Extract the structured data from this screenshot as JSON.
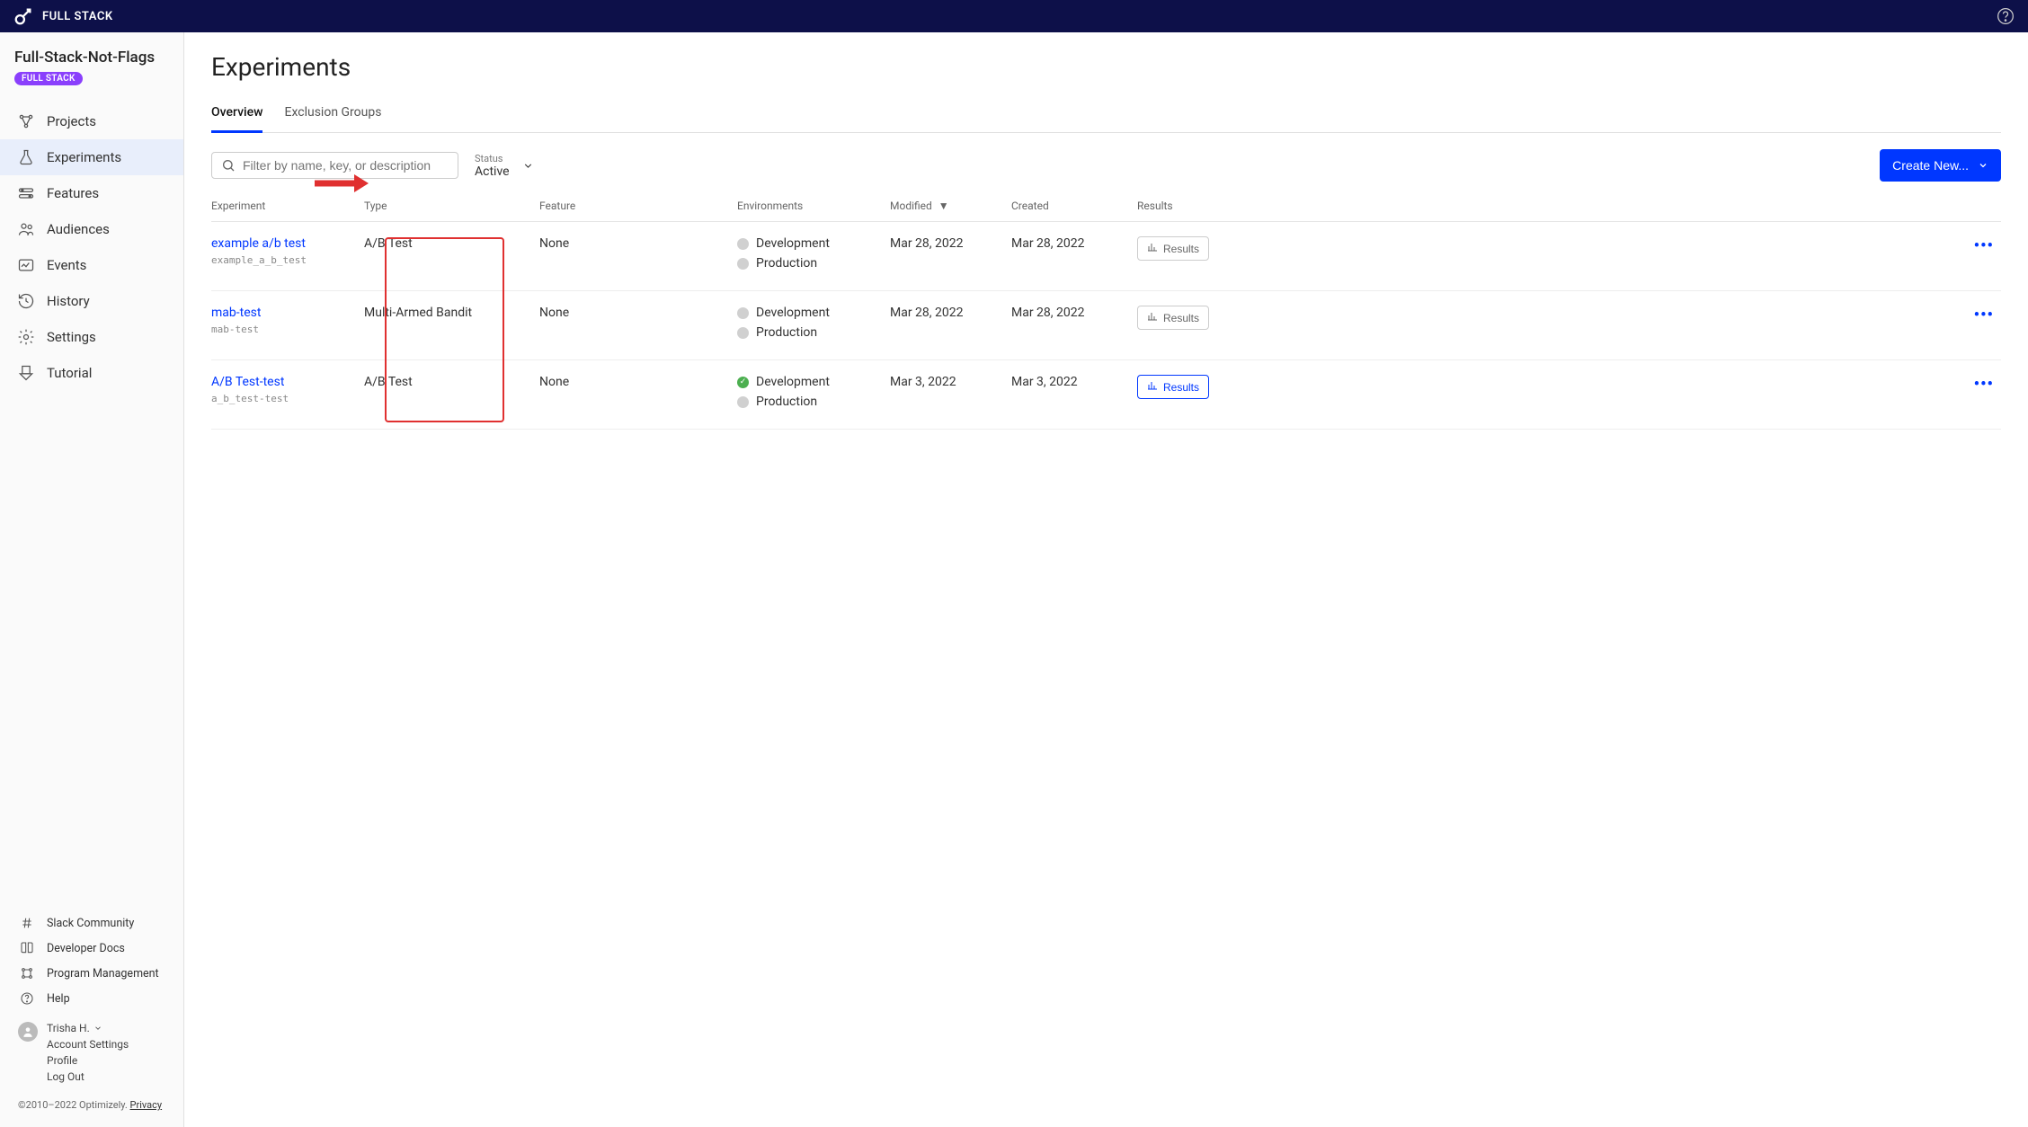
{
  "topbar": {
    "product": "FULL STACK"
  },
  "sidebar": {
    "project_name": "Full-Stack-Not-Flags",
    "badge": "FULL STACK",
    "nav": [
      {
        "label": "Projects",
        "icon": "projects-icon"
      },
      {
        "label": "Experiments",
        "icon": "flask-icon",
        "active": true
      },
      {
        "label": "Features",
        "icon": "features-icon"
      },
      {
        "label": "Audiences",
        "icon": "audiences-icon"
      },
      {
        "label": "Events",
        "icon": "events-icon"
      },
      {
        "label": "History",
        "icon": "history-icon"
      },
      {
        "label": "Settings",
        "icon": "gear-icon"
      },
      {
        "label": "Tutorial",
        "icon": "tutorial-icon"
      }
    ],
    "footer_links": [
      {
        "label": "Slack Community",
        "icon": "hash-icon"
      },
      {
        "label": "Developer Docs",
        "icon": "book-icon"
      },
      {
        "label": "Program Management",
        "icon": "pm-icon"
      },
      {
        "label": "Help",
        "icon": "help-icon"
      }
    ],
    "user": {
      "name": "Trisha H.",
      "links": [
        "Account Settings",
        "Profile",
        "Log Out"
      ]
    },
    "copyright": "©2010–2022 Optimizely.",
    "privacy": "Privacy"
  },
  "main": {
    "title": "Experiments",
    "tabs": [
      {
        "label": "Overview",
        "active": true
      },
      {
        "label": "Exclusion Groups"
      }
    ],
    "search_placeholder": "Filter by name, key, or description",
    "status_filter": {
      "label": "Status",
      "value": "Active"
    },
    "create_button": "Create New...",
    "columns": {
      "experiment": "Experiment",
      "type": "Type",
      "feature": "Feature",
      "environments": "Environments",
      "modified": "Modified",
      "created": "Created",
      "results": "Results"
    },
    "results_button": "Results",
    "rows": [
      {
        "name": "example a/b test",
        "key": "example_a_b_test",
        "type": "A/B Test",
        "feature": "None",
        "environments": [
          {
            "name": "Development",
            "running": false
          },
          {
            "name": "Production",
            "running": false
          }
        ],
        "modified": "Mar 28, 2022",
        "created": "Mar 28, 2022",
        "results_active": false
      },
      {
        "name": "mab-test",
        "key": "mab-test",
        "type": "Multi-Armed Bandit",
        "feature": "None",
        "environments": [
          {
            "name": "Development",
            "running": false
          },
          {
            "name": "Production",
            "running": false
          }
        ],
        "modified": "Mar 28, 2022",
        "created": "Mar 28, 2022",
        "results_active": false
      },
      {
        "name": "A/B Test-test",
        "key": "a_b_test-test",
        "type": "A/B Test",
        "feature": "None",
        "environments": [
          {
            "name": "Development",
            "running": true
          },
          {
            "name": "Production",
            "running": false
          }
        ],
        "modified": "Mar 3, 2022",
        "created": "Mar 3, 2022",
        "results_active": true
      }
    ]
  }
}
